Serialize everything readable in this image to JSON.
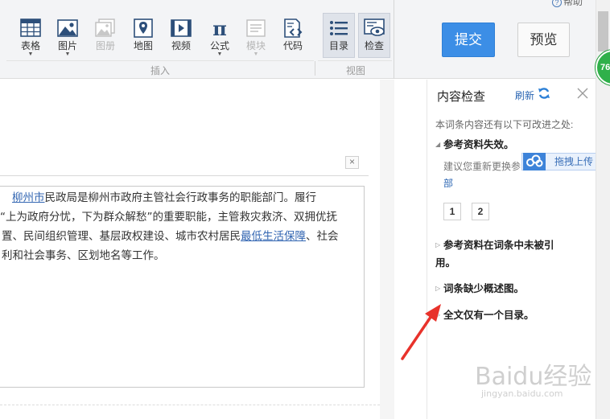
{
  "help": {
    "label": "帮助"
  },
  "toolbar": {
    "insert_group_label": "插入",
    "view_group_label": "视图",
    "buttons": [
      {
        "label": "表格",
        "icon": "table-icon",
        "has_dropdown": true
      },
      {
        "label": "图片",
        "icon": "picture-icon",
        "has_dropdown": true
      },
      {
        "label": "图册",
        "icon": "album-icon",
        "disabled": true
      },
      {
        "label": "地图",
        "icon": "map-icon"
      },
      {
        "label": "视频",
        "icon": "video-icon"
      },
      {
        "label": "公式",
        "icon": "formula-icon",
        "has_dropdown": true
      },
      {
        "label": "模块",
        "icon": "module-icon",
        "disabled": true,
        "has_dropdown": true
      },
      {
        "label": "代码",
        "icon": "code-icon"
      },
      {
        "label": "目录",
        "icon": "toc-icon",
        "active": true
      },
      {
        "label": "检查",
        "icon": "check-icon",
        "active": true
      }
    ],
    "submit_label": "提交",
    "preview_label": "预览"
  },
  "badge": {
    "text": "76"
  },
  "editor": {
    "close_symbol": "×",
    "paragraph": {
      "link1": "柳州市",
      "text1": "民政局是柳州市政府主管社会行政事务的职能部门。履行",
      "line2": "“上为政府分忧，下为群众解愁”的重要职能，主管救灾救济、双拥优抚",
      "text3a": "置、民间组织管理、基层政权建设、城市农村居民",
      "link2": "最低生活保障",
      "text3b": "、社会",
      "line4": "利和社会事务、区划地名等工作。"
    }
  },
  "panel": {
    "title": "内容检查",
    "refresh_label": "刷新",
    "subtitle": "本词条内容还有以下可改进之处:",
    "issue1": {
      "title": "参考资料失效。",
      "desc": "建议您重新更换参",
      "more": "部",
      "refs": [
        "1",
        "2"
      ]
    },
    "issue2": {
      "line1": "参考资料在词条中未被引",
      "line2": "用。"
    },
    "issue3": {
      "title": "词条缺少概述图。"
    },
    "issue4": {
      "title": "全文仅有一个目录。"
    }
  },
  "upload": {
    "label": "拖拽上传"
  },
  "watermark": {
    "big": "Baidu经验",
    "small": "jingyan.baidu.com"
  },
  "colors": {
    "primary": "#3c8ee6",
    "link": "#2b66b3",
    "arrow": "#e8322b",
    "badge": "#2fb04a"
  }
}
